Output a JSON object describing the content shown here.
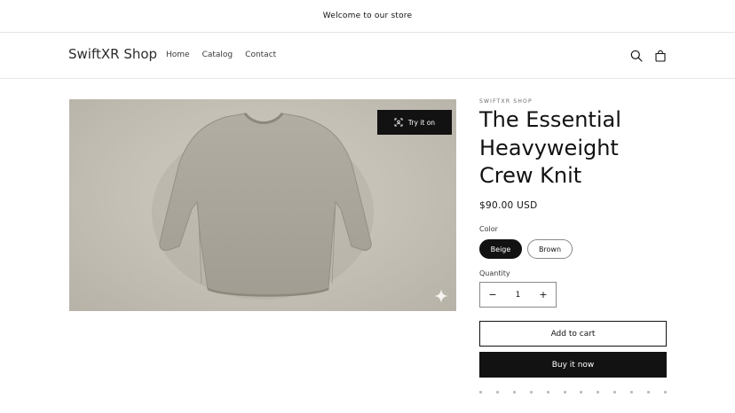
{
  "announcement": {
    "text": "Welcome to our store"
  },
  "header": {
    "logo": "SwiftXR Shop",
    "nav": [
      "Home",
      "Catalog",
      "Contact"
    ],
    "icons": {
      "search": "search-icon",
      "cart": "cart-icon"
    }
  },
  "media": {
    "try_button_label": "Try it on",
    "try_icon": "ar-scan-icon",
    "badge_icon": "sparkle-icon"
  },
  "product": {
    "vendor": "SWIFTXR SHOP",
    "title": "The Essential Heavyweight Crew Knit",
    "price": "$90.00 USD",
    "color_label": "Color",
    "colors": [
      "Beige",
      "Brown"
    ],
    "selected_color": "Beige",
    "quantity_label": "Quantity",
    "quantity": "1",
    "decrease_symbol": "−",
    "increase_symbol": "+",
    "add_to_cart_label": "Add to cart",
    "buy_now_label": "Buy it now"
  },
  "colors": {
    "primary": "#121212",
    "border": "#e6e6e6",
    "background": "#ffffff"
  }
}
